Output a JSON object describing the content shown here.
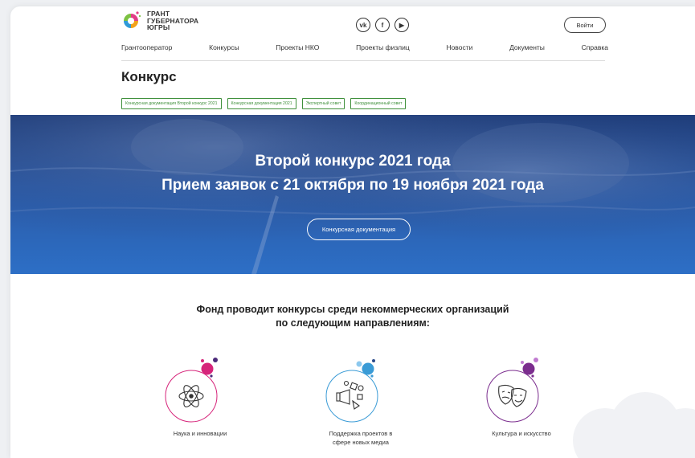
{
  "logo": {
    "line1": "ГРАНТ",
    "line2": "ГУБЕРНАТОРА",
    "line3": "ЮГРЫ"
  },
  "socials": [
    {
      "icon": "vk-icon",
      "glyph": "vk"
    },
    {
      "icon": "facebook-icon",
      "glyph": "f"
    },
    {
      "icon": "youtube-icon",
      "glyph": "▶"
    }
  ],
  "login_label": "Войти",
  "nav": [
    "Грантооператор",
    "Конкурсы",
    "Проекты НКО",
    "Проекты физлиц",
    "Новости",
    "Документы",
    "Справка"
  ],
  "page_title": "Конкурс",
  "tags": [
    "Конкурсная документация Второй конкурс 2021",
    "Конкурсная документация 2021",
    "Экспертный совет",
    "Координационный совет"
  ],
  "hero": {
    "line1": "Второй конкурс 2021 года",
    "line2": "Прием заявок с 21 октября по 19 ноября 2021 года",
    "button": "Конкурсная документация"
  },
  "intro": {
    "line1": "Фонд проводит конкурсы среди некоммерческих организаций",
    "line2": "по следующим направлениям:"
  },
  "directions": [
    {
      "label1": "Наука и инновации",
      "label2": "",
      "icon": "atom-icon",
      "color": "#d6247a"
    },
    {
      "label1": "Поддержка проектов в",
      "label2": "сфере новых медиа",
      "icon": "media-icon",
      "color": "#3a9bd6"
    },
    {
      "label1": "Культура и искусство",
      "label2": "",
      "icon": "theater-masks-icon",
      "color": "#7b2d8e"
    }
  ],
  "colors": {
    "accent_green": "#3e8f3a",
    "hero_blue": "#2b5aa6"
  }
}
